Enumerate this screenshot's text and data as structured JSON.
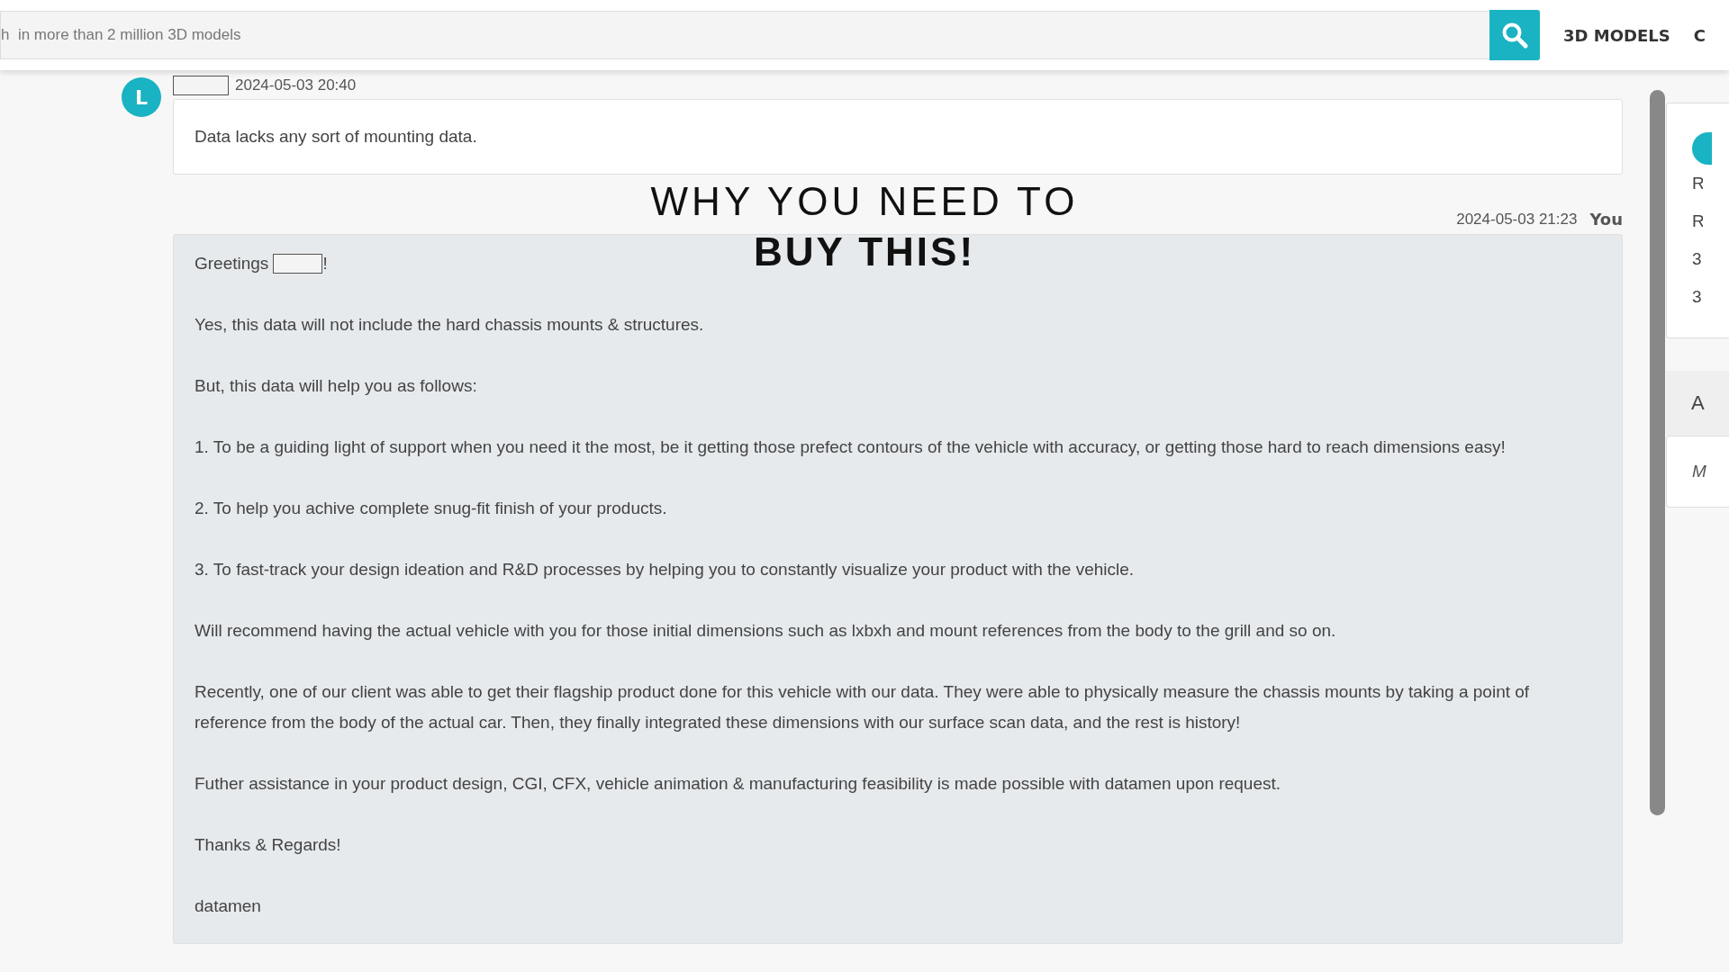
{
  "header": {
    "search": {
      "placeholder": "h  in more than 2 million 3D models"
    },
    "nav": [
      {
        "label": "3D MODELS"
      },
      {
        "label": "C"
      }
    ]
  },
  "messages": [
    {
      "kind": "received",
      "avatar": "L",
      "time": "2024-05-03 20:40",
      "paragraphs": [
        "Data lacks any sort of mounting data."
      ]
    },
    {
      "kind": "sent",
      "author": "You",
      "time": "2024-05-03 21:23",
      "paragraphs": [
        "Greetings !",
        "Yes, this data will not include the hard chassis mounts & structures.",
        "But, this data will help you as follows:",
        "1. To be a guiding light of support when you need it the most, be it getting those prefect contours of the vehicle with accuracy, or getting those hard to reach dimensions easy!",
        "2. To help you achive complete snug-fit finish of your products.",
        "3. To fast-track your design ideation and R&D processes by helping you to constantly visualize your product with the vehicle.",
        "Will recommend having the actual vehicle with you for those initial dimensions such as lxbxh and mount references from the body to the grill and so on.",
        "Recently, one of our client was able to get their flagship product done for this vehicle with our data. They were able to physically measure the chassis mounts by taking a point of reference from the body of the actual car. Then, they finally integrated these dimensions with our surface scan data, and the rest is history!",
        "Futher assistance in your product design, CGI, CFX, vehicle animation & manufacturing feasibility is made possible with datamen upon request.",
        "Thanks & Regards!",
        "datamen"
      ]
    }
  ],
  "sidebar": {
    "card_lines": [
      "R",
      "R",
      "3",
      "3"
    ],
    "panel_title": "A",
    "panel_text": "M"
  },
  "overlay_caption": [
    "WHY YOU NEED TO",
    "BUY THIS!"
  ]
}
